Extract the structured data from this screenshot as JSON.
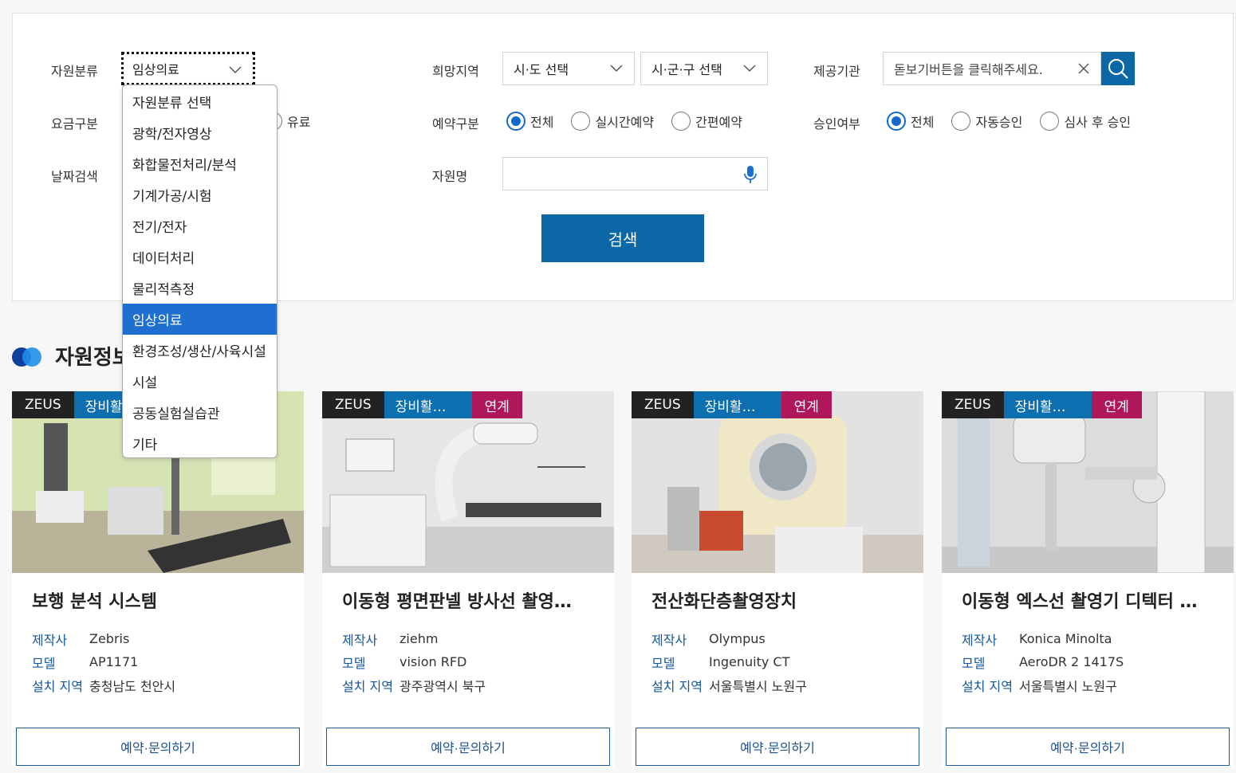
{
  "filters": {
    "category_label": "자원분류",
    "category_value": "임상의료",
    "region_label": "희망지역",
    "region_sido": "시·도 선택",
    "region_sigungu": "시·군·구 선택",
    "provider_label": "제공기관",
    "provider_placeholder": "돋보기버튼을 클릭해주세요.",
    "fee_label": "요금구분",
    "fee_paid": "유료",
    "reserve_label": "예약구분",
    "reserve_options": [
      "전체",
      "실시간예약",
      "간편예약"
    ],
    "approve_label": "승인여부",
    "approve_options": [
      "전체",
      "자동승인",
      "심사 후 승인"
    ],
    "date_label": "날짜검색",
    "name_label": "자원명",
    "name_value": "",
    "search_button": "검색"
  },
  "dropdown": {
    "items": [
      "자원분류 선택",
      "광학/전자영상",
      "화합물전처리/분석",
      "기계가공/시험",
      "전기/전자",
      "데이터처리",
      "물리적측정",
      "임상의료",
      "환경조성/생산/사육시설",
      "시설",
      "공동실험실습관",
      "기타"
    ],
    "selected_index": 7
  },
  "section": {
    "title": "자원정보"
  },
  "colors": {
    "accent": "#0b67a6",
    "tag_equip": "#0d6fb0",
    "tag_link": "#b0165a",
    "dropdown_selected": "#1f6fd1"
  },
  "cards": [
    {
      "tags": [
        "ZEUS",
        "장비활용",
        ""
      ],
      "name": "보행 분석 시스템",
      "maker_k": "제작사",
      "maker": "Zebris",
      "model_k": "모델",
      "model": "AP1171",
      "loc_k": "설치 지역",
      "loc": "충청남도 천안시",
      "cta": "예약·문의하기"
    },
    {
      "tags": [
        "ZEUS",
        "장비활…",
        "연계"
      ],
      "name": "이동형 평면판넬 방사선 촬영…",
      "maker_k": "제작사",
      "maker": "ziehm",
      "model_k": "모델",
      "model": "vision RFD",
      "loc_k": "설치 지역",
      "loc": "광주광역시 북구",
      "cta": "예약·문의하기"
    },
    {
      "tags": [
        "ZEUS",
        "장비활…",
        "연계"
      ],
      "name": "전산화단층촬영장치",
      "maker_k": "제작사",
      "maker": "Olympus",
      "model_k": "모델",
      "model": "Ingenuity CT",
      "loc_k": "설치 지역",
      "loc": "서울특별시 노원구",
      "cta": "예약·문의하기"
    },
    {
      "tags": [
        "ZEUS",
        "장비활…",
        "연계"
      ],
      "name": "이동형 엑스선 촬영기 디텍터 …",
      "maker_k": "제작사",
      "maker": "Konica Minolta",
      "model_k": "모델",
      "model": "AeroDR 2 1417S",
      "loc_k": "설치 지역",
      "loc": "서울특별시 노원구",
      "cta": "예약·문의하기"
    }
  ]
}
